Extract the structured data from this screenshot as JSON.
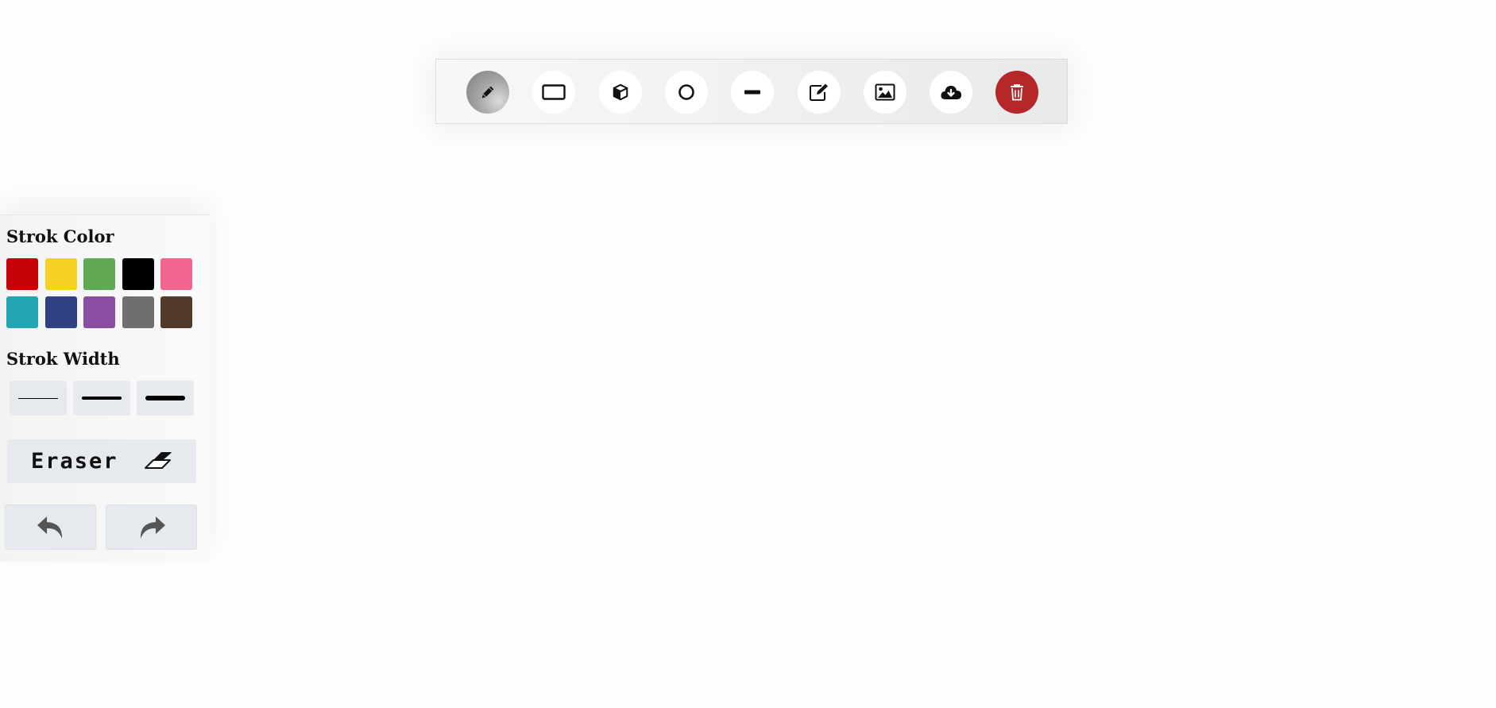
{
  "toolbar": {
    "tools": [
      {
        "name": "pencil-icon",
        "label": "Pencil",
        "active": true
      },
      {
        "name": "rectangle-icon",
        "label": "Rectangle"
      },
      {
        "name": "cube-icon",
        "label": "Cube"
      },
      {
        "name": "circle-icon",
        "label": "Circle"
      },
      {
        "name": "line-icon",
        "label": "Line"
      },
      {
        "name": "text-edit-icon",
        "label": "Text"
      },
      {
        "name": "image-icon",
        "label": "Image"
      },
      {
        "name": "cloud-download-icon",
        "label": "Download"
      },
      {
        "name": "trash-icon",
        "label": "Clear",
        "color": "#b5282a"
      }
    ]
  },
  "side_panel": {
    "stroke_color_heading": "Strok Color",
    "colors": [
      "#c60208",
      "#f4d122",
      "#62a955",
      "#000000",
      "#f2678f",
      "#22a6b4",
      "#304283",
      "#894ea1",
      "#6f6f6f",
      "#533a28"
    ],
    "stroke_width_heading": "Strok Width",
    "widths": [
      1,
      4,
      6
    ],
    "eraser_label": "Eraser",
    "undo_icon": "undo-icon",
    "redo_icon": "redo-icon"
  },
  "colors": {
    "active_tool": "#8a8a8a",
    "danger": "#b5282a",
    "button_bg": "#e6e9ee"
  }
}
